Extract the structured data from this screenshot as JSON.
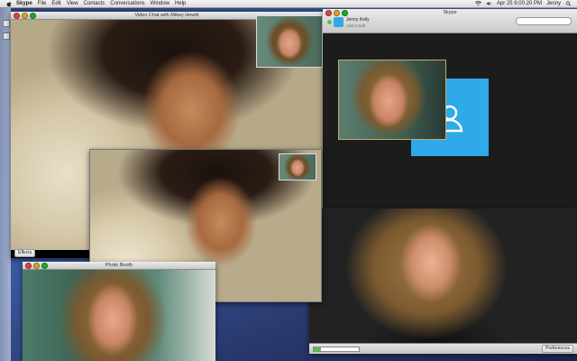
{
  "menubar": {
    "app": "Skype",
    "items": [
      "File",
      "Edit",
      "View",
      "Contacts",
      "Conversations",
      "Window",
      "Help"
    ],
    "date_time": "Apr 25  9:00:20 PM",
    "user": "Jenny"
  },
  "video_chat": {
    "title": "Video Chat with Mikey Hewitt",
    "effects_label": "Effects"
  },
  "skype": {
    "title": "Skype",
    "contact_name": "Jenny Kelly",
    "contact_status": "Add Credit",
    "preferences_label": "Preferences"
  },
  "photo_booth": {
    "title": "Photo Booth"
  },
  "icons": [
    "apple-icon",
    "wifi-icon",
    "volume-icon",
    "search-icon",
    "profile-placeholder-icon"
  ],
  "colors": {
    "desktop": "#2d3f74",
    "skype_dark": "#1c1c1c",
    "skype_blue": "#2ea9ea",
    "progress_green": "#59c04b"
  }
}
